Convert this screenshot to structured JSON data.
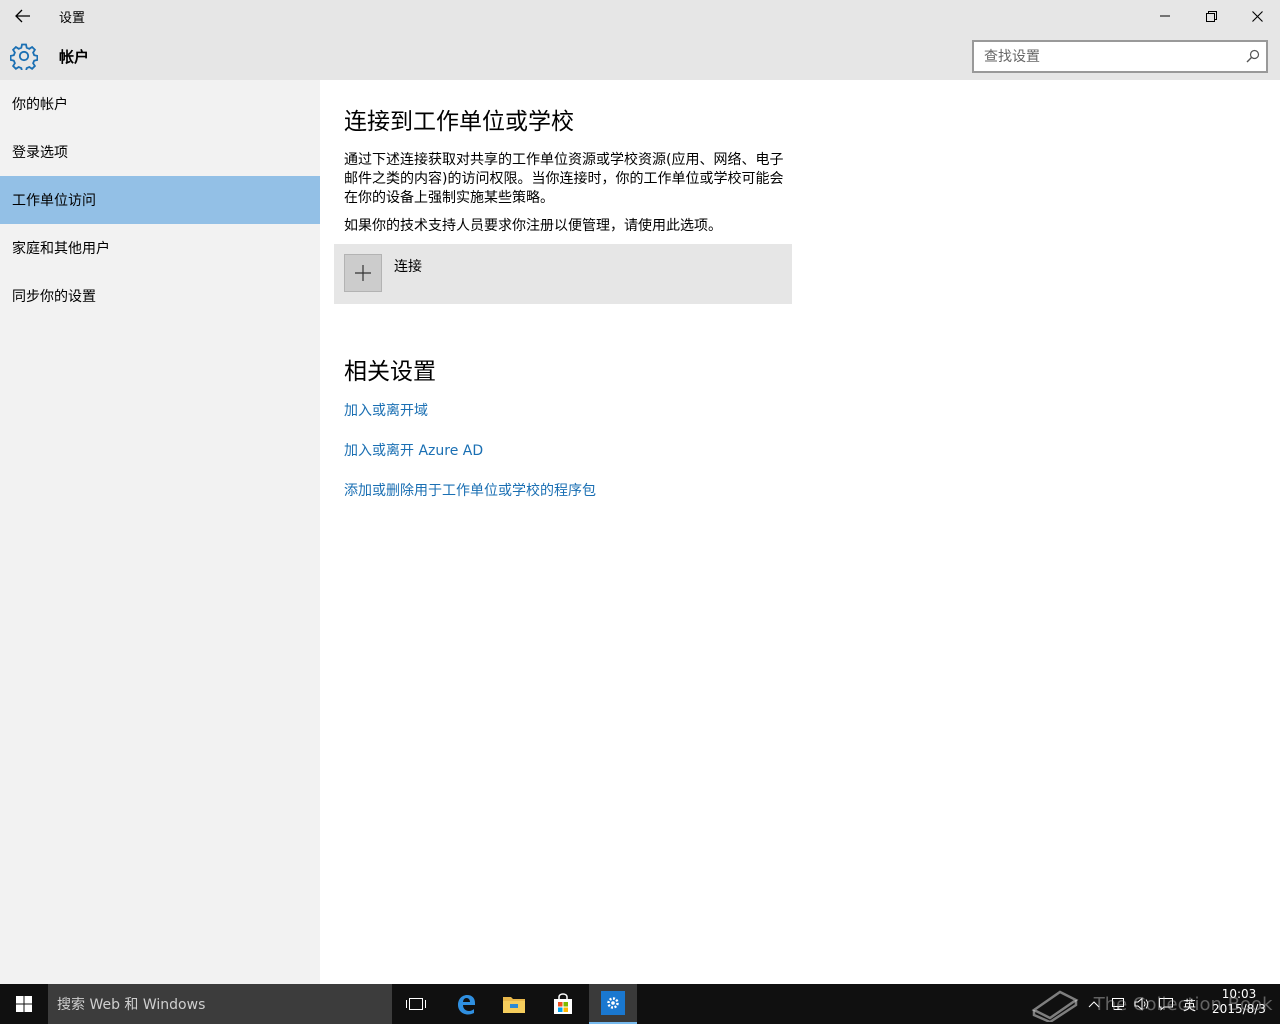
{
  "window": {
    "title": "设置"
  },
  "header": {
    "title": "帐户",
    "search_placeholder": "查找设置"
  },
  "sidebar": {
    "items": [
      {
        "label": "你的帐户"
      },
      {
        "label": "登录选项"
      },
      {
        "label": "工作单位访问",
        "selected": true
      },
      {
        "label": "家庭和其他用户"
      },
      {
        "label": "同步你的设置"
      }
    ]
  },
  "main": {
    "heading": "连接到工作单位或学校",
    "description": "通过下述连接获取对共享的工作单位资源或学校资源(应用、网络、电子邮件之类的内容)的访问权限。当你连接时，你的工作单位或学校可能会在你的设备上强制实施某些策略。",
    "note": "如果你的技术支持人员要求你注册以便管理，请使用此选项。",
    "connect_label": "连接",
    "related_heading": "相关设置",
    "links": [
      {
        "label": "加入或离开域"
      },
      {
        "label": "加入或离开 Azure AD"
      },
      {
        "label": "添加或删除用于工作单位或学校的程序包"
      }
    ]
  },
  "taskbar": {
    "search_placeholder": "搜索 Web 和 Windows",
    "ime": "英",
    "time": "10:03",
    "date": "2015/8/3"
  },
  "watermark": "The Collection Book",
  "colors": {
    "accent": "#1a6fb3",
    "selected_nav": "#93c0e6",
    "taskbar": "#101010"
  }
}
